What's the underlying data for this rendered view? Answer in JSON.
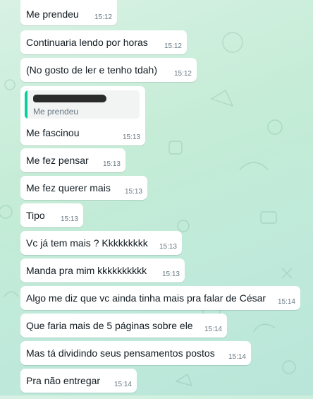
{
  "chat": {
    "messages": [
      {
        "text": "Me prendeu",
        "time": "15:12"
      },
      {
        "text": "Continuaria lendo por horas",
        "time": "15:12"
      },
      {
        "text": "(No gosto de ler e tenho tdah)",
        "time": "15:12"
      },
      {
        "quote": {
          "text": "Me prendeu",
          "author_redacted": true
        },
        "text": "Me fascinou",
        "time": "15:13"
      },
      {
        "text": "Me fez pensar",
        "time": "15:13"
      },
      {
        "text": "Me fez querer mais",
        "time": "15:13"
      },
      {
        "text": "Tipo",
        "time": "15:13"
      },
      {
        "text": "Vc já tem mais ? Kkkkkkkkk",
        "time": "15:13"
      },
      {
        "text": "Manda pra mim kkkkkkkkkk",
        "time": "15:13"
      },
      {
        "text": "Algo me diz que vc ainda tinha mais pra falar de César",
        "time": "15:14"
      },
      {
        "text": "Que faria mais de 5 páginas sobre ele",
        "time": "15:14"
      },
      {
        "text": "Mas tá dividindo seus pensamentos postos",
        "time": "15:14"
      },
      {
        "text": "Pra não entregar",
        "time": "15:14"
      }
    ]
  },
  "colors": {
    "bubble": "#ffffff",
    "quote_bar": "#06cf9c",
    "wallpaper": "#c4ecd6"
  }
}
